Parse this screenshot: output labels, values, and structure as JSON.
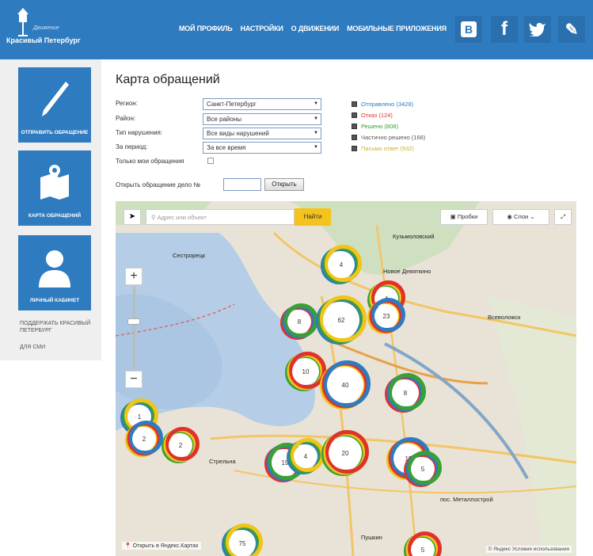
{
  "header": {
    "logo_small": "Движение",
    "logo_name": "Красивый Петербург",
    "nav": [
      "МОЙ ПРОФИЛЬ",
      "НАСТРОЙКИ",
      "О ДВИЖЕНИИ",
      "МОБИЛЬНЫЕ ПРИЛОЖЕНИЯ"
    ],
    "social": {
      "vk": "B",
      "fb": "f",
      "tw": "🐦",
      "mail": "✎"
    }
  },
  "sidebar": {
    "cards": [
      "ОТПРАВИТЬ ОБРАЩЕНИЕ",
      "КАРТА ОБРАЩЕНИЙ",
      "ЛИЧНЫЙ КАБИНЕТ"
    ],
    "links": [
      "ПОДДЕРЖАТЬ КРАСИВЫЙ ПЕТЕРБУРГ",
      "ДЛЯ СМИ"
    ]
  },
  "page": {
    "title": "Карта обращений",
    "filters": {
      "region_label": "Регион:",
      "region_value": "Санкт-Петербург",
      "district_label": "Район:",
      "district_value": "Все районы",
      "type_label": "Тип нарушения:",
      "type_value": "Все виды нарушений",
      "period_label": "За период:",
      "period_value": "За все время",
      "only_mine_label": "Только мои обращения"
    },
    "legend": [
      {
        "label": "Отправлено (3428)",
        "color": "#2f7bbf"
      },
      {
        "label": "Отказ (124)",
        "color": "#e0312a"
      },
      {
        "label": "Решено (808)",
        "color": "#3aa035"
      },
      {
        "label": "Частично решено (166)",
        "color": "#555555"
      },
      {
        "label": "Письмо ответ (932)",
        "color": "#c9b22a"
      }
    ],
    "open_label": "Открыть обращение дело №",
    "open_button": "Открыть"
  },
  "map": {
    "search_placeholder": "Адрес или объект",
    "find_button": "Найти",
    "traffic_button": "Пробки",
    "layers_button": "Слои",
    "open_yandex": "Открыть в Яндекс.Картах",
    "copyright": "© Яндекс Условия использования",
    "place_labels": [
      "Кузьмоловский",
      "Новое Девяткино",
      "Всеволожск",
      "Сестрорецк",
      "Стрельна",
      "Пушкин",
      "пос. Металлострой"
    ],
    "clusters": [
      {
        "label": "4"
      },
      {
        "label": "4"
      },
      {
        "label": "23"
      },
      {
        "label": "8"
      },
      {
        "label": "62"
      },
      {
        "label": "10"
      },
      {
        "label": "40"
      },
      {
        "label": "8"
      },
      {
        "label": "1"
      },
      {
        "label": "2"
      },
      {
        "label": "2"
      },
      {
        "label": "19"
      },
      {
        "label": "4"
      },
      {
        "label": "20"
      },
      {
        "label": "15"
      },
      {
        "label": "5"
      },
      {
        "label": "75"
      },
      {
        "label": "5"
      }
    ]
  }
}
